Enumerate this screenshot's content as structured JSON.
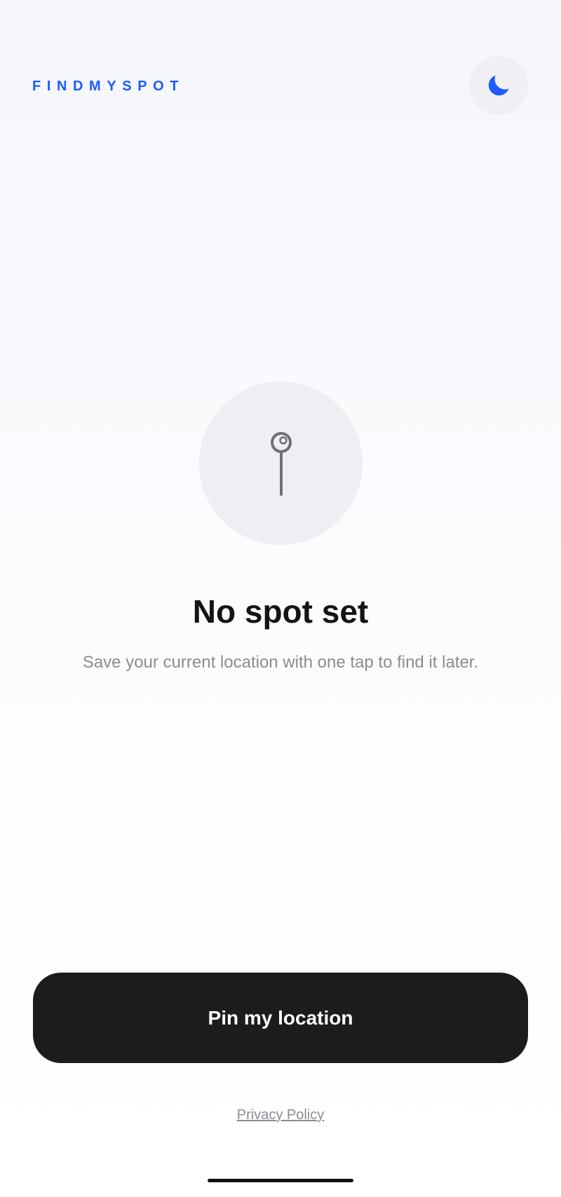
{
  "app": {
    "brand": "FINDMYSPOT",
    "theme_toggle_icon": "moon-icon",
    "accent_color": "#1a5cff"
  },
  "empty_state": {
    "icon": "map-pin-icon",
    "title": "No spot set",
    "description": "Save your current location with one tap to find it later."
  },
  "actions": {
    "pin_button_label": "Pin my location",
    "privacy_link_label": "Privacy Policy"
  }
}
